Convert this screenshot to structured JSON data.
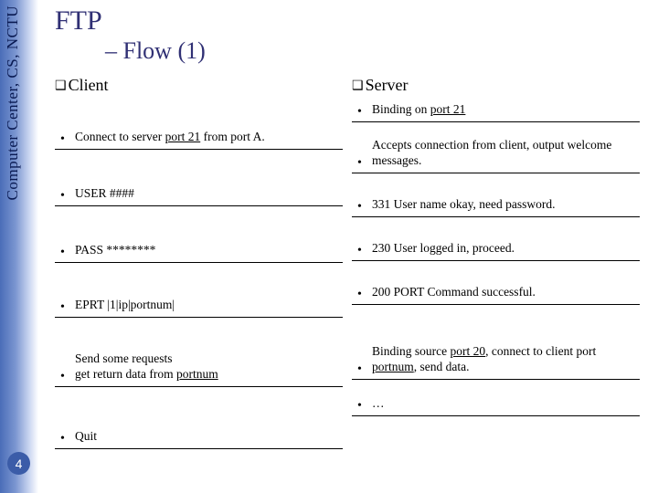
{
  "sidebar": {
    "org": "Computer Center, CS, NCTU"
  },
  "page_number": "4",
  "title": "FTP",
  "subtitle": "– Flow (1)",
  "client": {
    "heading": "Client",
    "items": [
      {
        "pre": "Connect to server ",
        "u": "port 21",
        "post": " from port A."
      },
      {
        "pre": "USER ####"
      },
      {
        "pre": "PASS ********"
      },
      {
        "pre": "EPRT |1|ip|portnum|"
      },
      {
        "pre": "Send some requests\nget return data from ",
        "u": "portnum"
      },
      {
        "pre": "Quit"
      }
    ]
  },
  "server": {
    "heading": "Server",
    "items": [
      {
        "pre": "Binding on ",
        "u": "port 21"
      },
      {
        "pre": "Accepts connection from client, output welcome messages."
      },
      {
        "pre": "331 User name okay, need password."
      },
      {
        "pre": "230 User logged in, proceed."
      },
      {
        "pre": "200 PORT Command successful."
      },
      {
        "pre": "Binding source ",
        "u": "port 20",
        "post": ", connect to client port ",
        "u2": "portnum",
        "post2": ", send data."
      },
      {
        "pre": "…"
      }
    ]
  },
  "row_heights": {
    "client": [
      "54",
      "62",
      "62",
      "60",
      "76",
      "68"
    ],
    "server": [
      "24",
      "56",
      "48",
      "48",
      "48",
      "82",
      "40"
    ]
  }
}
